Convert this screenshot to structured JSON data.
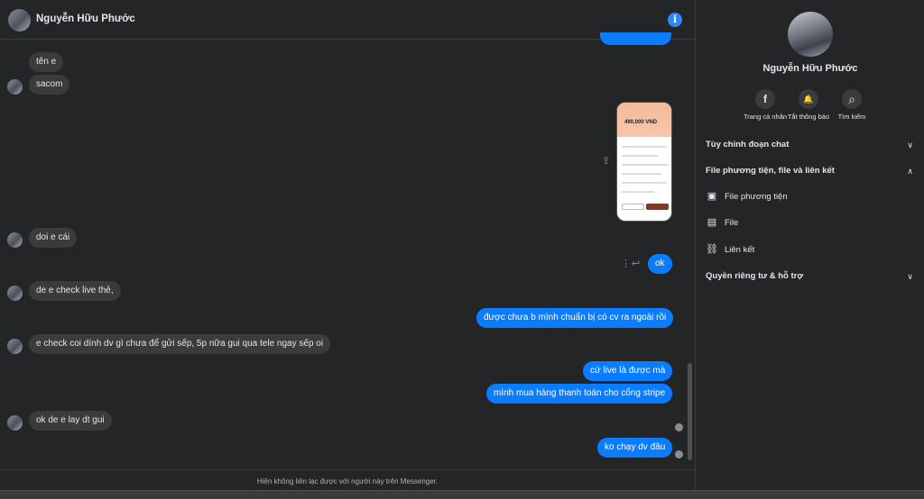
{
  "header": {
    "name": "Nguyễn Hữu Phước",
    "info_icon": "i"
  },
  "messages": {
    "m1": "tên e",
    "m2": "sacom",
    "m3": "doi e cái",
    "m4": "ok",
    "m5": "de e check live thẻ,",
    "m6": "được chưa b mình chuẩn bị có cv ra ngoài rồi",
    "m7": "e check coi dính dv gì chưa để gửi sếp, 5p nữa gui qua tele ngay sếp oi",
    "m8": "cứ live là được mà",
    "m9": "mình mua hàng thanh toán cho cổng stripe",
    "m10": "ok de e lay dt gui",
    "m11": "ko chạy dv đâu"
  },
  "attachment": {
    "price": "490,000 VND"
  },
  "footer": {
    "text": "Hiện không liên lạc được với người này trên Messenger."
  },
  "sidebar": {
    "name": "Nguyễn Hữu Phước",
    "actions": [
      {
        "label": "Trang cá nhân",
        "icon": "facebook-icon",
        "glyph": "f"
      },
      {
        "label": "Tắt thông báo",
        "icon": "bell-icon",
        "glyph": "🔔"
      },
      {
        "label": "Tìm kiếm",
        "icon": "search-icon",
        "glyph": "⌕"
      }
    ],
    "sections": {
      "customize": "Tùy chỉnh đoạn chat",
      "media": "File phương tiện, file và liên kết",
      "privacy": "Quyền riêng tư & hỗ trợ"
    },
    "media_items": {
      "media": "File phương tiện",
      "file": "File",
      "link": "Liên kết"
    }
  },
  "colors": {
    "accent": "#0a7cff",
    "background": "#242526",
    "bubble_in": "#3a3b3c"
  }
}
